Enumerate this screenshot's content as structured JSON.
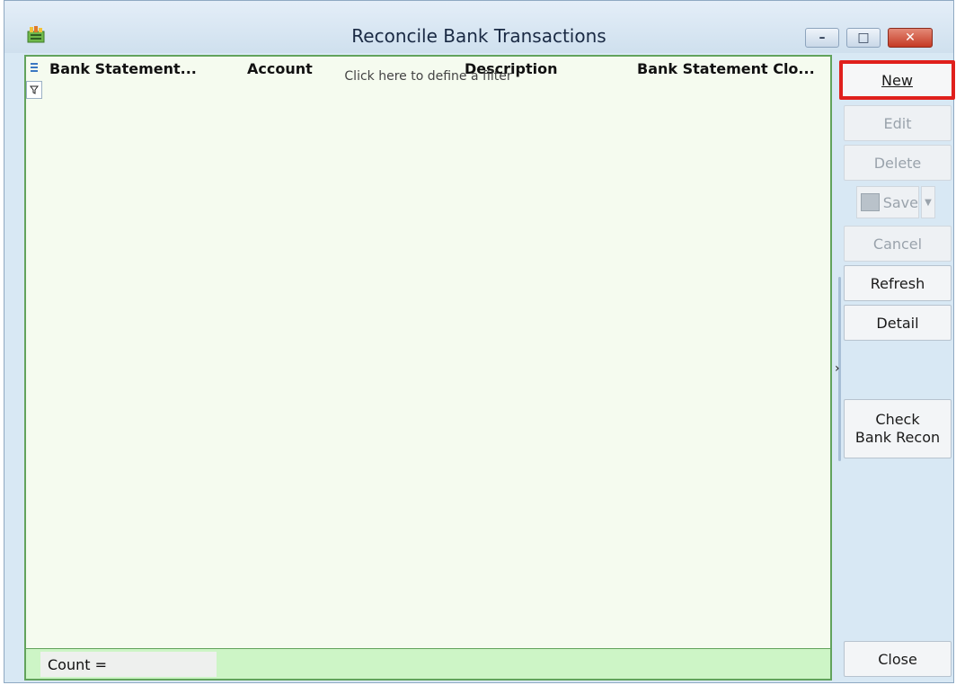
{
  "window": {
    "title": "Reconcile Bank Transactions",
    "controls": {
      "minimize": "–",
      "maximize": "□",
      "close": "✕"
    }
  },
  "grid": {
    "columns": [
      "Bank Statement...",
      "Account",
      "Description",
      "Bank Statement Clo..."
    ],
    "filter_text": "Click here to define a filter"
  },
  "toolbar": {
    "new_label": "New",
    "edit_label": "Edit",
    "delete_label": "Delete",
    "save_label": "Save",
    "cancel_label": "Cancel",
    "refresh_label": "Refresh",
    "detail_label": "Detail",
    "check_label_1": "Check",
    "check_label_2": "Bank Recon",
    "close_label": "Close"
  },
  "status": {
    "count_label": "Count ="
  },
  "colors": {
    "grid_border": "#62a35c",
    "grid_bg": "#f5fbef",
    "status_bg": "#cdf5c6",
    "highlight": "#e0201c"
  },
  "icons": [
    "app-icon",
    "column-menu-icon",
    "filter-icon",
    "save-icon",
    "dropdown-arrow-icon",
    "chevron-right-icon"
  ]
}
